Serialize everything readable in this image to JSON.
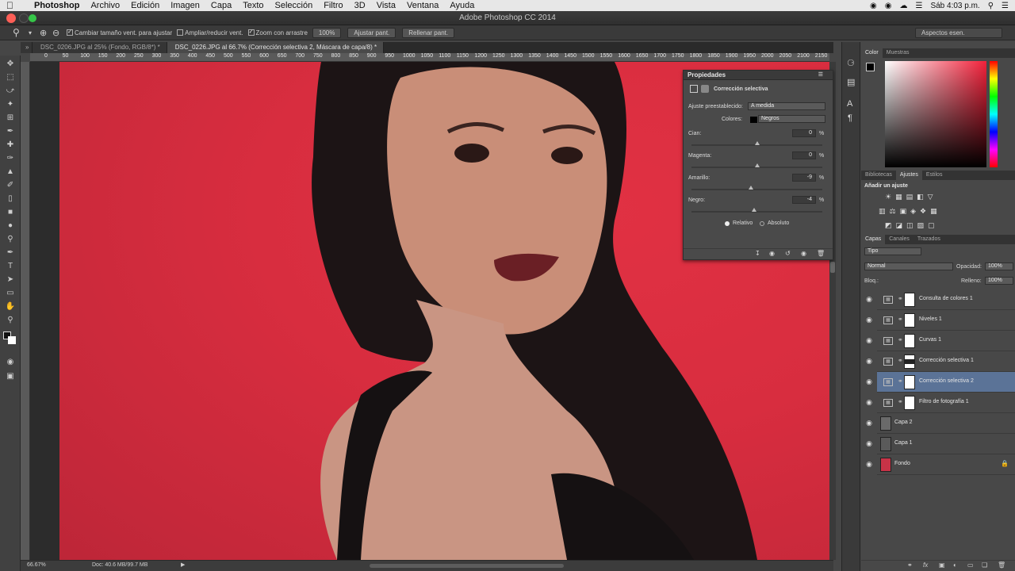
{
  "mac_menu": {
    "app": "Photoshop",
    "items": [
      "Archivo",
      "Edición",
      "Imagen",
      "Capa",
      "Texto",
      "Selección",
      "Filtro",
      "3D",
      "Vista",
      "Ventana",
      "Ayuda"
    ],
    "clock": "Sáb 4:03 p.m."
  },
  "window_title": "Adobe Photoshop CC 2014",
  "options_bar": {
    "opt1": "Cambiar tamaño vent. para ajustar",
    "opt2": "Ampliar/reducir vent.",
    "opt3": "Zoom con arrastre",
    "zoom_btn": "100%",
    "fit_btn": "Ajustar pant.",
    "fill_btn": "Rellenar pant.",
    "workspace": "Aspectos esen."
  },
  "doc_tabs": [
    "DSC_0206.JPG al 25% (Fondo, RGB/8*) *",
    "DSC_0226.JPG al 66.7% (Corrección selectiva 2, Máscara de capa/8) *"
  ],
  "ruler_ticks": [
    "0",
    "50",
    "100",
    "150",
    "200",
    "250",
    "300",
    "350",
    "400",
    "450",
    "500",
    "550",
    "600",
    "650",
    "700",
    "750",
    "800",
    "850",
    "900",
    "950",
    "1000",
    "1050",
    "1100",
    "1150",
    "1200",
    "1250",
    "1300",
    "1350",
    "1400",
    "1450",
    "1500",
    "1550",
    "1600",
    "1650",
    "1700",
    "1750",
    "1800",
    "1850",
    "1900",
    "1950",
    "2000",
    "2050",
    "2100",
    "2150"
  ],
  "status": {
    "zoom": "66.67%",
    "doc": "Doc: 40.6 MB/99.7 MB"
  },
  "properties": {
    "panel_title": "Propiedades",
    "title": "Corrección selectiva",
    "preset_label": "Ajuste preestablecido:",
    "preset_value": "A medida",
    "colors_label": "Colores:",
    "colors_value": "Negros",
    "sliders": [
      {
        "label": "Cian:",
        "value": "0",
        "pos": 0.5
      },
      {
        "label": "Magenta:",
        "value": "0",
        "pos": 0.5
      },
      {
        "label": "Amarillo:",
        "value": "-9",
        "pos": 0.455
      },
      {
        "label": "Negro:",
        "value": "-4",
        "pos": 0.48
      }
    ],
    "radio_rel": "Relativo",
    "radio_abs": "Absoluto"
  },
  "color_panel": {
    "tabs": [
      "Color",
      "Muestras"
    ]
  },
  "adjust_panel": {
    "tabs": [
      "Bibliotecas",
      "Ajustes",
      "Estilos"
    ],
    "heading": "Añadir un ajuste"
  },
  "layers_panel": {
    "tabs": [
      "Capas",
      "Canales",
      "Trazados"
    ],
    "kind": "Tipo",
    "blend": "Normal",
    "opacity_label": "Opacidad:",
    "opacity": "100%",
    "lock_label": "Bloq.:",
    "fill_label": "Relleno:",
    "fill": "100%",
    "layers": [
      {
        "name": "Consulta de colores 1",
        "type": "adjust",
        "selected": false
      },
      {
        "name": "Niveles 1",
        "type": "adjust",
        "selected": false
      },
      {
        "name": "Curvas 1",
        "type": "adjust",
        "selected": false
      },
      {
        "name": "Corrección selectiva 1",
        "type": "adjust",
        "selected": false
      },
      {
        "name": "Corrección selectiva 2",
        "type": "adjust",
        "selected": true
      },
      {
        "name": "Filtro de fotografía 1",
        "type": "adjust",
        "selected": false
      },
      {
        "name": "Capa 2",
        "type": "pixel",
        "selected": false
      },
      {
        "name": "Capa 1",
        "type": "pixel",
        "selected": false
      },
      {
        "name": "Fondo",
        "type": "pixel",
        "selected": false
      }
    ]
  },
  "colors": {
    "accent": "#5b7397",
    "backdrop": "#d82d3f"
  }
}
